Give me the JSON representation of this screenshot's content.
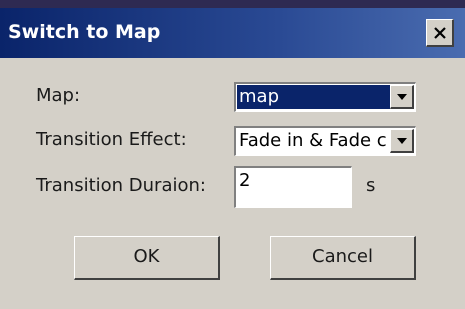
{
  "dialog": {
    "title": "Switch to Map",
    "close_icon": "close-icon"
  },
  "fields": {
    "map_label": "Map:",
    "map_value": "map",
    "transition_effect_label": "Transition Effect:",
    "transition_effect_value": "Fade in & Fade c",
    "transition_duration_label": "Transition Duraion:",
    "transition_duration_value": "2",
    "duration_unit": "s"
  },
  "buttons": {
    "ok_label": "OK",
    "cancel_label": "Cancel"
  },
  "colors": {
    "titlebar": "#0a246a",
    "face": "#d4d0c8",
    "selection": "#0a246a"
  }
}
